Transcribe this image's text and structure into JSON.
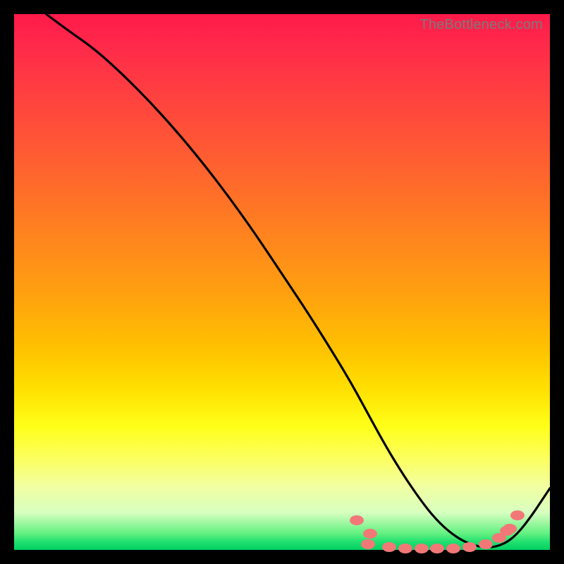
{
  "watermark": "TheBottleneck.com",
  "chart_data": {
    "type": "line",
    "title": "",
    "xlabel": "",
    "ylabel": "",
    "xlim": [
      0,
      100
    ],
    "ylim": [
      0,
      100
    ],
    "grid": false,
    "legend": false,
    "series": [
      {
        "name": "curve",
        "x": [
          6,
          10,
          15,
          20,
          25,
          30,
          35,
          40,
          45,
          50,
          55,
          60,
          63,
          66,
          69,
          72,
          75,
          78,
          81,
          84,
          87,
          90,
          93,
          96,
          100
        ],
        "y": [
          100,
          97,
          93.5,
          89,
          84,
          78.5,
          72.5,
          66,
          59,
          51.5,
          44,
          36,
          31,
          25.5,
          20,
          15,
          10.5,
          6.5,
          3.5,
          1.5,
          0.5,
          0.5,
          2,
          5.5,
          11.5
        ]
      }
    ],
    "markers": {
      "name": "cluster",
      "points": [
        {
          "x": 66,
          "y": 1
        },
        {
          "x": 70,
          "y": 0.5
        },
        {
          "x": 73,
          "y": 0.3
        },
        {
          "x": 76,
          "y": 0.2
        },
        {
          "x": 79,
          "y": 0.2
        },
        {
          "x": 82,
          "y": 0.3
        },
        {
          "x": 85,
          "y": 0.5
        },
        {
          "x": 88,
          "y": 1
        },
        {
          "x": 90.5,
          "y": 2.2
        },
        {
          "x": 92,
          "y": 3.5
        }
      ]
    },
    "marker_pair_upper": [
      {
        "x": 64,
        "y": 5.5
      },
      {
        "x": 66.5,
        "y": 3
      },
      {
        "x": 92.5,
        "y": 4
      },
      {
        "x": 94,
        "y": 6.5
      }
    ]
  }
}
